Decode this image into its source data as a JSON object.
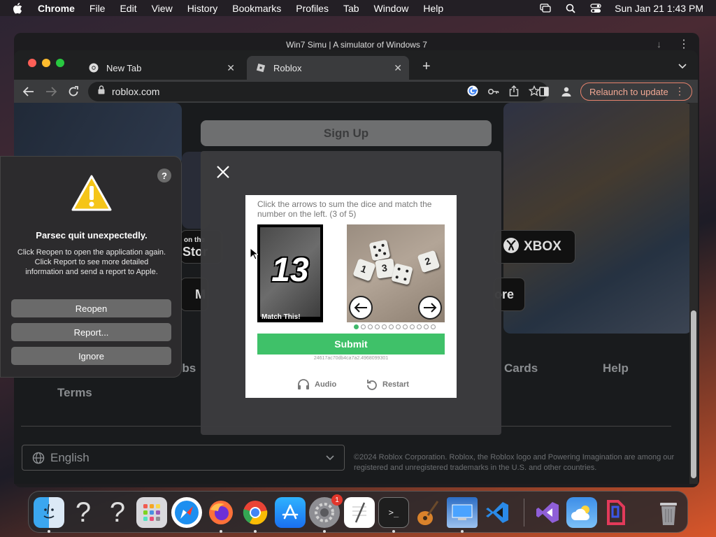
{
  "menubar": {
    "app_name": "Chrome",
    "items": [
      "File",
      "Edit",
      "View",
      "History",
      "Bookmarks",
      "Profiles",
      "Tab",
      "Window",
      "Help"
    ],
    "datetime": "Sun Jan 21  1:43 PM"
  },
  "background_window": {
    "title": "Win7 Simu | A simulator of Windows 7"
  },
  "browser": {
    "tabs": [
      {
        "label": "New Tab",
        "icon": "chrome-icon"
      },
      {
        "label": "Roblox",
        "icon": "roblox-icon"
      }
    ],
    "url": "roblox.com",
    "relaunch_label": "Relaunch to update"
  },
  "roblox": {
    "signup_label": "Sign Up",
    "store_buttons": [
      "on the",
      "Stor",
      "XBOX",
      "M",
      "ore"
    ],
    "footer_links": [
      "obs",
      "Cards",
      "Help",
      "Terms"
    ],
    "language": "English",
    "copyright": "©2024 Roblox Corporation. Roblox, the Roblox logo and Powering Imagination are among our registered and unregistered trademarks in the U.S. and other countries."
  },
  "captcha": {
    "instruction": "Click the arrows to sum the dice and match the number on the left. (3 of 5)",
    "target_number": "13",
    "target_label": "Match This!",
    "dice_faces": [
      "1",
      "3",
      "2"
    ],
    "dot_count": 12,
    "active_dot": 0,
    "submit_label": "Submit",
    "session_id": "24617ac70db4ca7a2.4968099301",
    "audio_label": "Audio",
    "restart_label": "Restart"
  },
  "crash_dialog": {
    "title": "Parsec quit unexpectedly.",
    "message": "Click Reopen to open the application again. Click Report to see more detailed information and send a report to Apple.",
    "help_label": "?",
    "buttons": [
      "Reopen",
      "Report...",
      "Ignore"
    ]
  },
  "dock": {
    "apps": [
      "Finder",
      "Unknown",
      "Unknown",
      "Launchpad",
      "Safari",
      "Firefox",
      "Chrome",
      "App Store",
      "System Settings",
      "TextEdit",
      "Terminal",
      "GarageBand",
      "Win7 Simu",
      "Visual Studio Code",
      "Visual Studio",
      "Weather",
      "Parsec",
      "Trash"
    ],
    "settings_badge": "1"
  },
  "colors": {
    "submit_green": "#3fc169",
    "relaunch_accent": "#e8836d",
    "warning_yellow": "#f5c518"
  }
}
